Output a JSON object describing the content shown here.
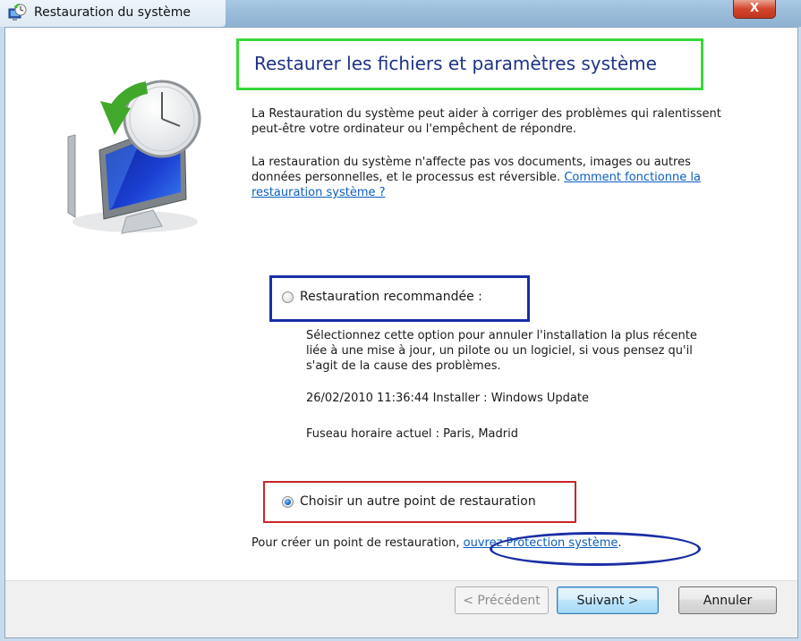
{
  "window": {
    "title": "Restauration du système",
    "close_label": "X"
  },
  "content": {
    "heading": "Restaurer les fichiers et paramètres système",
    "intro": "La Restauration du système peut aider à corriger des problèmes qui ralentissent peut-être votre ordinateur ou l'empêchent de répondre.",
    "info_text": "La restauration du système n'affecte pas vos documents, images ou autres données personnelles, et le processus est réversible.",
    "info_link": "Comment fonctionne la restauration système ?",
    "option_recommended": {
      "label": "Restauration recommandée :",
      "checked": false,
      "description": "Sélectionnez cette option pour annuler l'installation la plus récente liée à une mise à jour, un pilote ou un logiciel, si vous pensez qu'il s'agit de la cause des problèmes.",
      "restore_point": "26/02/2010 11:36:44 Installer : Windows Update",
      "timezone": "Fuseau horaire actuel : Paris, Madrid"
    },
    "option_choose": {
      "label": "Choisir un autre point de restauration",
      "checked": true
    },
    "create_text": "Pour créer un point de restauration,",
    "create_link": "ouvrez Protection système",
    "create_end": "."
  },
  "buttons": {
    "previous": "< Précédent",
    "next": "Suivant >",
    "cancel": "Annuler"
  },
  "colors": {
    "heading": "#1e3287",
    "link": "#0b5ec0",
    "highlight_green": "#39d83a",
    "highlight_blue": "#1a2ea5",
    "highlight_red": "#c8262b"
  }
}
